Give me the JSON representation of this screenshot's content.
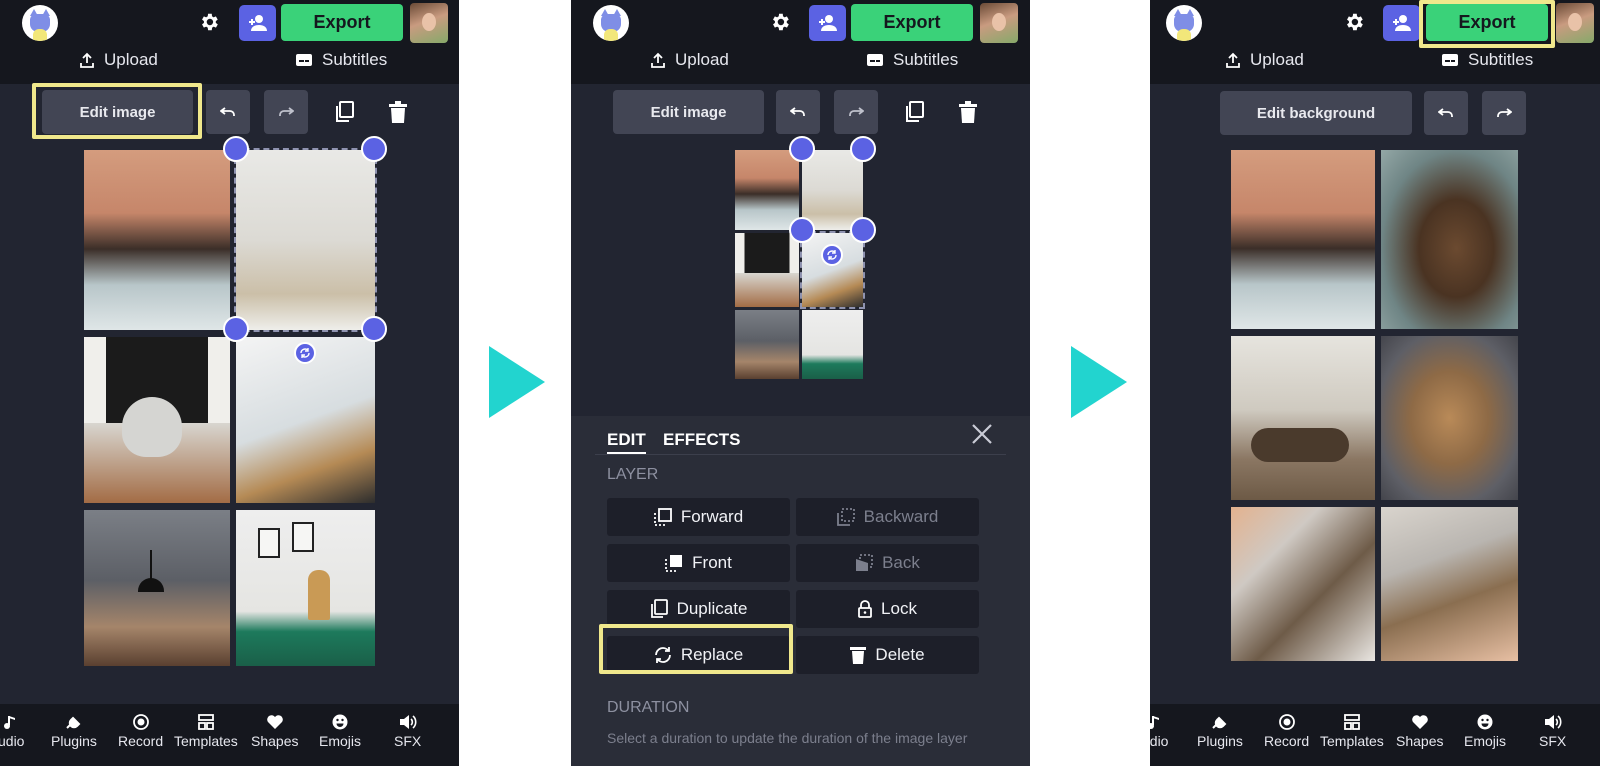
{
  "header": {
    "export_label": "Export",
    "upload_label": "Upload",
    "subtitles_label": "Subtitles"
  },
  "frame1": {
    "edit_button_label": "Edit image"
  },
  "frame2": {
    "edit_button_label": "Edit image",
    "panel": {
      "tab_edit": "EDIT",
      "tab_effects": "EFFECTS",
      "layer_heading": "LAYER",
      "forward_label": "Forward",
      "backward_label": "Backward",
      "front_label": "Front",
      "back_label": "Back",
      "duplicate_label": "Duplicate",
      "lock_label": "Lock",
      "replace_label": "Replace",
      "delete_label": "Delete",
      "duration_heading": "DURATION",
      "duration_text": "Select a duration to update the duration of the image layer"
    }
  },
  "frame3": {
    "edit_button_label": "Edit background"
  },
  "bottom_nav": {
    "audio": "udio",
    "plugins": "Plugins",
    "record": "Record",
    "templates": "Templates",
    "shapes": "Shapes",
    "emojis": "Emojis",
    "sfx": "SFX"
  },
  "colors": {
    "accent_purple": "#5b62e3",
    "export_green": "#3ad279",
    "highlight_yellow": "#f0e88c",
    "arrow_teal": "#22d4cf",
    "app_background": "#222531"
  },
  "icons": [
    "cat-logo-icon",
    "gear-icon",
    "add-user-icon",
    "upload-icon",
    "subtitles-icon",
    "undo-icon",
    "redo-icon",
    "duplicate-icon",
    "trash-icon",
    "rotate-icon",
    "close-icon",
    "forward-icon",
    "backward-icon",
    "front-icon",
    "back-icon",
    "lock-icon",
    "replace-icon",
    "music-icon",
    "plugin-icon",
    "record-icon",
    "templates-icon",
    "heart-icon",
    "emoji-icon",
    "speaker-icon"
  ]
}
